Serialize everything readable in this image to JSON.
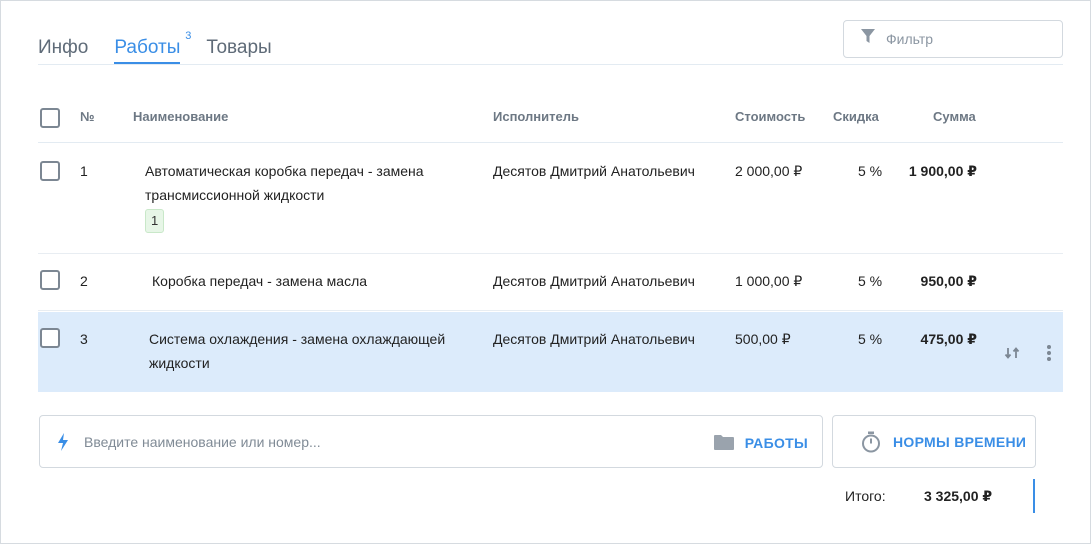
{
  "tabs": [
    {
      "label": "Инфо",
      "active": false
    },
    {
      "label": "Работы",
      "active": true,
      "count": "3"
    },
    {
      "label": "Товары",
      "active": false
    }
  ],
  "filter": {
    "placeholder": "Фильтр",
    "icon": "filter-icon"
  },
  "table": {
    "columns": {
      "num": "№",
      "name": "Наименование",
      "executor": "Исполнитель",
      "cost": "Стоимость",
      "discount": "Скидка",
      "sum": "Сумма"
    },
    "rows": [
      {
        "num": "1",
        "name_line1": "Автоматическая коробка передач - замена",
        "name_line2": "трансмиссионной жидкости",
        "badge": "1",
        "executor": "Десятов Дмитрий Анатольевич",
        "cost": "2 000,00 ₽",
        "discount": "5 %",
        "sum": "1 900,00 ₽",
        "selected": false
      },
      {
        "num": "2",
        "name_line1": "Коробка передач - замена масла",
        "executor": "Десятов Дмитрий Анатольевич",
        "cost": "1 000,00 ₽",
        "discount": "5 %",
        "sum": "950,00 ₽",
        "selected": false
      },
      {
        "num": "3",
        "name_line1": "Система охлаждения - замена охлаждающей",
        "name_line2": "жидкости",
        "executor": "Десятов Дмитрий Анатольевич",
        "cost": "500,00 ₽",
        "discount": "5 %",
        "sum": "475,00 ₽",
        "selected": true
      }
    ]
  },
  "add_input": {
    "placeholder": "Введите наименование или номер...",
    "works_label": "РАБОТЫ",
    "icon": "lightning-icon"
  },
  "norms_button": {
    "label": "НОРМЫ ВРЕМЕНИ",
    "icon": "stopwatch-icon"
  },
  "total": {
    "label": "Итого:",
    "value": "3 325,00 ₽"
  },
  "colors": {
    "accent": "#3a8ee6",
    "selected_row": "#dcebfb",
    "badge_bg": "#e7f6e7"
  }
}
